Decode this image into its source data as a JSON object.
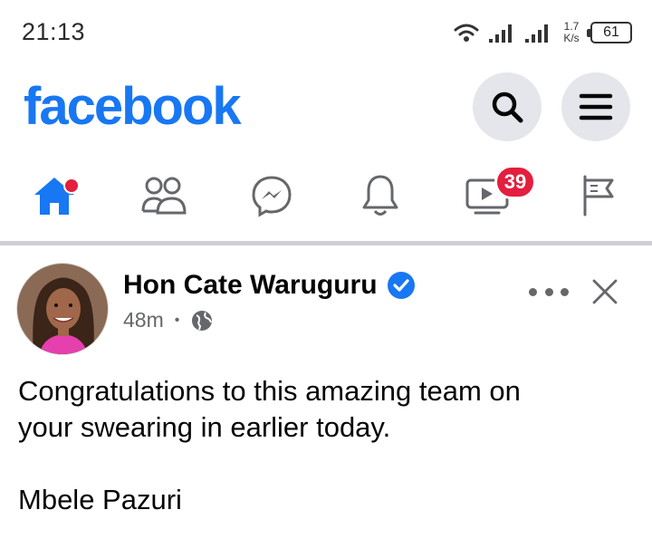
{
  "status_bar": {
    "time": "21:13",
    "net_speed_value": "1.7",
    "net_speed_unit": "K/s",
    "battery": "61"
  },
  "header": {
    "logo": "facebook",
    "brand_color": "#1877f2"
  },
  "tabs": [
    {
      "name": "home",
      "icon": "home-icon",
      "active": true
    },
    {
      "name": "friends",
      "icon": "friends-icon"
    },
    {
      "name": "messenger",
      "icon": "messenger-icon"
    },
    {
      "name": "notifications",
      "icon": "bell-icon"
    },
    {
      "name": "watch",
      "icon": "video-icon",
      "badge": "39"
    },
    {
      "name": "pages",
      "icon": "flag-icon"
    }
  ],
  "post": {
    "author": "Hon Cate Waruguru",
    "verified": true,
    "time": "48m",
    "privacy": "globe-icon",
    "text_lines": [
      "Congratulations to this amazing team on",
      "your swearing in earlier today.",
      "Mbele Pazuri"
    ]
  },
  "colors": {
    "badge": "#e41e3f",
    "icon_gray": "#65676b",
    "divider": "#ced0d4"
  }
}
